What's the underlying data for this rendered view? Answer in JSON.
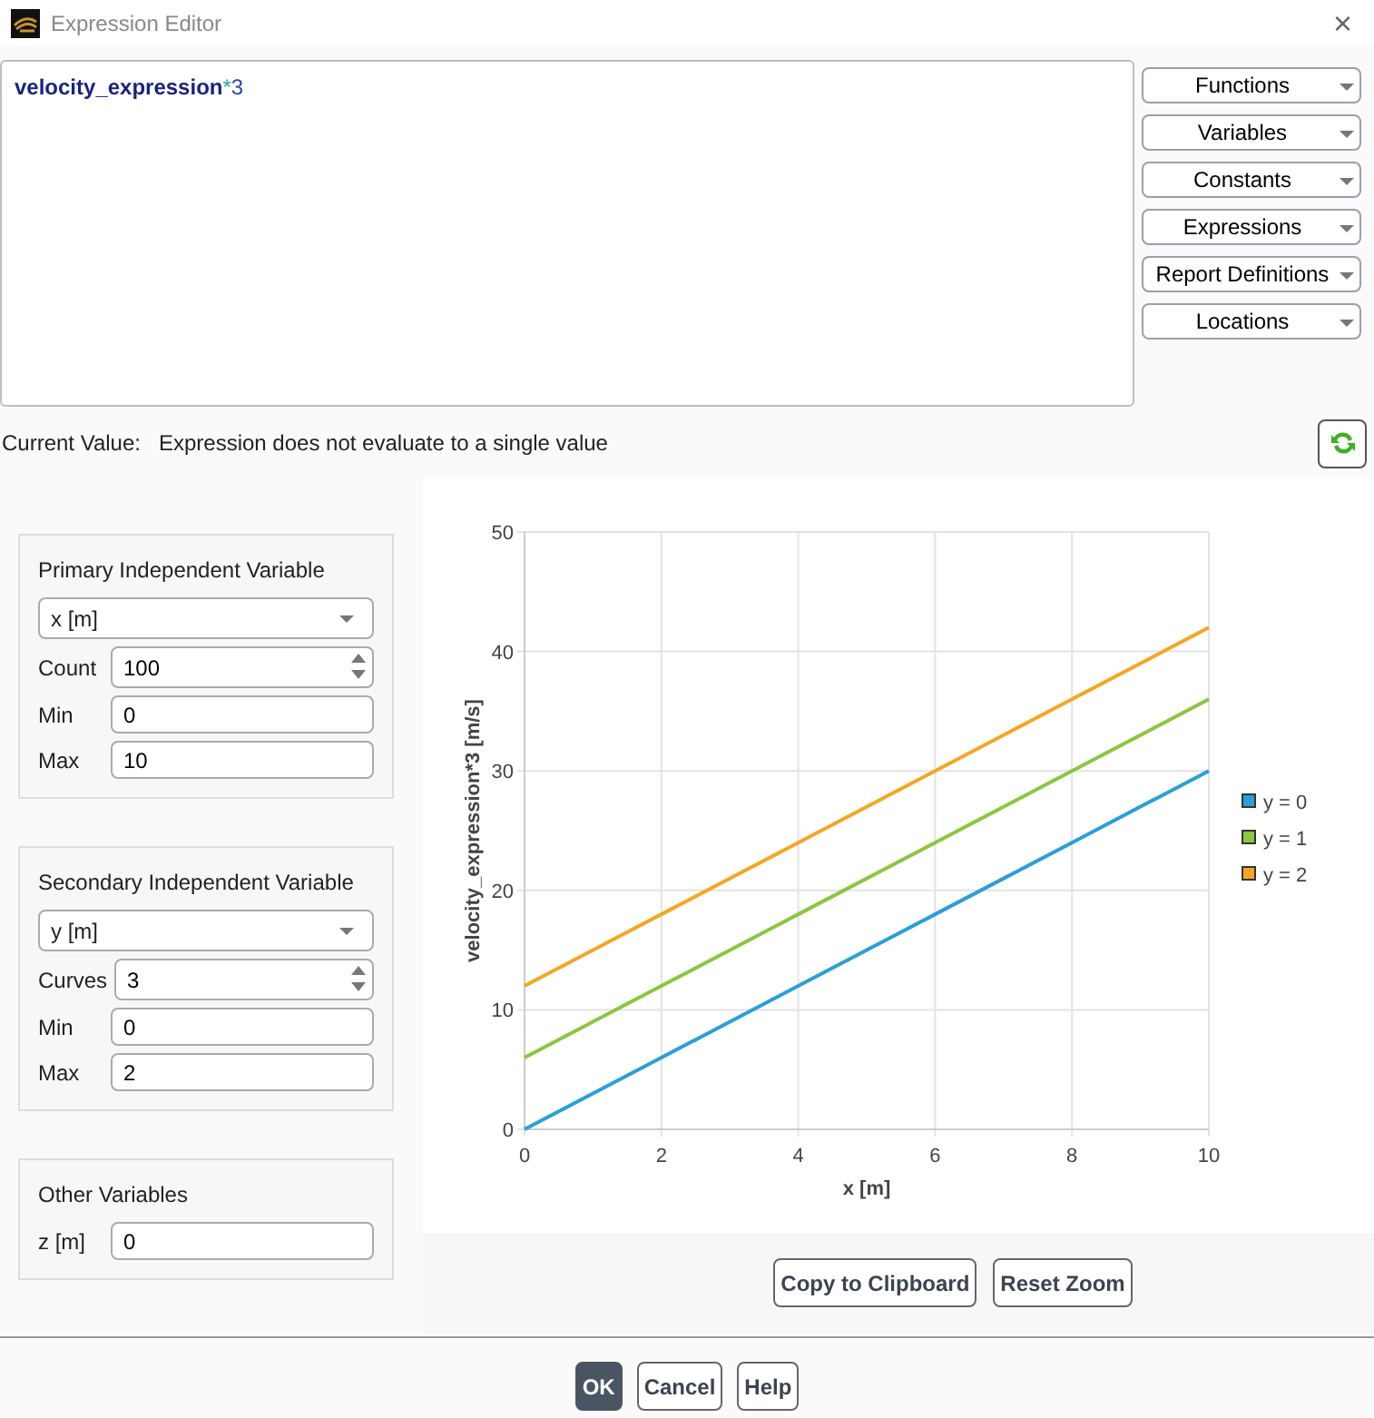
{
  "window": {
    "title": "Expression Editor",
    "close": "×"
  },
  "expression": [
    {
      "kind": "name",
      "text": "velocity_expression"
    },
    {
      "kind": "operator",
      "text": "*"
    },
    {
      "kind": "number",
      "text": "3"
    }
  ],
  "menus": [
    "Functions",
    "Variables",
    "Constants",
    "Expressions",
    "Report Definitions",
    "Locations"
  ],
  "current_value": {
    "label": "Current Value:",
    "text": "Expression does not evaluate to a single value"
  },
  "panels": [
    {
      "title": "Primary Independent Variable",
      "select": "x [m]",
      "fields": [
        {
          "kind": "spin",
          "label": "Count",
          "value": "100"
        },
        {
          "kind": "text",
          "label": "Min",
          "value": "0"
        },
        {
          "kind": "text",
          "label": "Max",
          "value": "10"
        }
      ]
    },
    {
      "title": "Secondary Independent Variable",
      "select": "y [m]",
      "fields": [
        {
          "kind": "spin",
          "label": "Curves",
          "value": "3"
        },
        {
          "kind": "text",
          "label": "Min",
          "value": "0"
        },
        {
          "kind": "text",
          "label": "Max",
          "value": "2"
        }
      ]
    },
    {
      "title": "Other Variables",
      "fields": [
        {
          "kind": "text",
          "label": "z [m]",
          "value": "0"
        }
      ]
    }
  ],
  "chart_data": {
    "type": "line",
    "xlabel": "x [m]",
    "ylabel": "velocity_expression*3 [m/s]",
    "x": [
      0,
      2,
      4,
      6,
      8,
      10
    ],
    "series": [
      {
        "name": "y = 0",
        "color": "#2a9fd8",
        "values": [
          0,
          6,
          12,
          18,
          24,
          30
        ]
      },
      {
        "name": "y = 1",
        "color": "#8cc63f",
        "values": [
          6,
          12,
          18,
          24,
          30,
          36
        ]
      },
      {
        "name": "y = 2",
        "color": "#f5a623",
        "values": [
          12,
          18,
          24,
          30,
          36,
          42
        ]
      }
    ],
    "grid": true,
    "legend": true,
    "xlim": [
      0,
      10
    ],
    "ylim": [
      0,
      50
    ],
    "xticks": [
      0,
      2,
      4,
      6,
      8,
      10
    ],
    "yticks": [
      0,
      10,
      20,
      30,
      40,
      50
    ]
  },
  "chart_buttons": [
    "Copy to Clipboard",
    "Reset Zoom"
  ],
  "buttons": [
    {
      "label": "OK",
      "kind": "primary"
    },
    {
      "label": "Cancel",
      "kind": "normal"
    },
    {
      "label": "Help",
      "kind": "normal"
    }
  ]
}
